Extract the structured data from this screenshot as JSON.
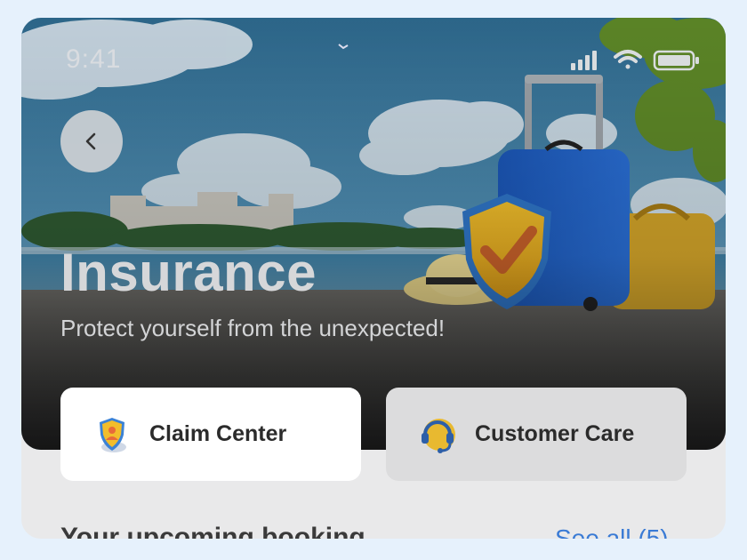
{
  "status_bar": {
    "time": "9:41"
  },
  "hero": {
    "title": "Insurance",
    "subtitle": "Protect yourself from the unexpected!"
  },
  "actions": [
    {
      "label": "Claim Center",
      "icon": "shield-person-icon",
      "selected": true
    },
    {
      "label": "Customer Care",
      "icon": "headset-icon",
      "selected": false
    }
  ],
  "upcoming": {
    "title": "Your upcoming booking",
    "see_all": "See all (5)"
  },
  "colors": {
    "page_bg": "#e6f1fc",
    "link": "#3a7bd5",
    "card_active": "#ffffff",
    "card_inactive": "#dcdcdd"
  }
}
